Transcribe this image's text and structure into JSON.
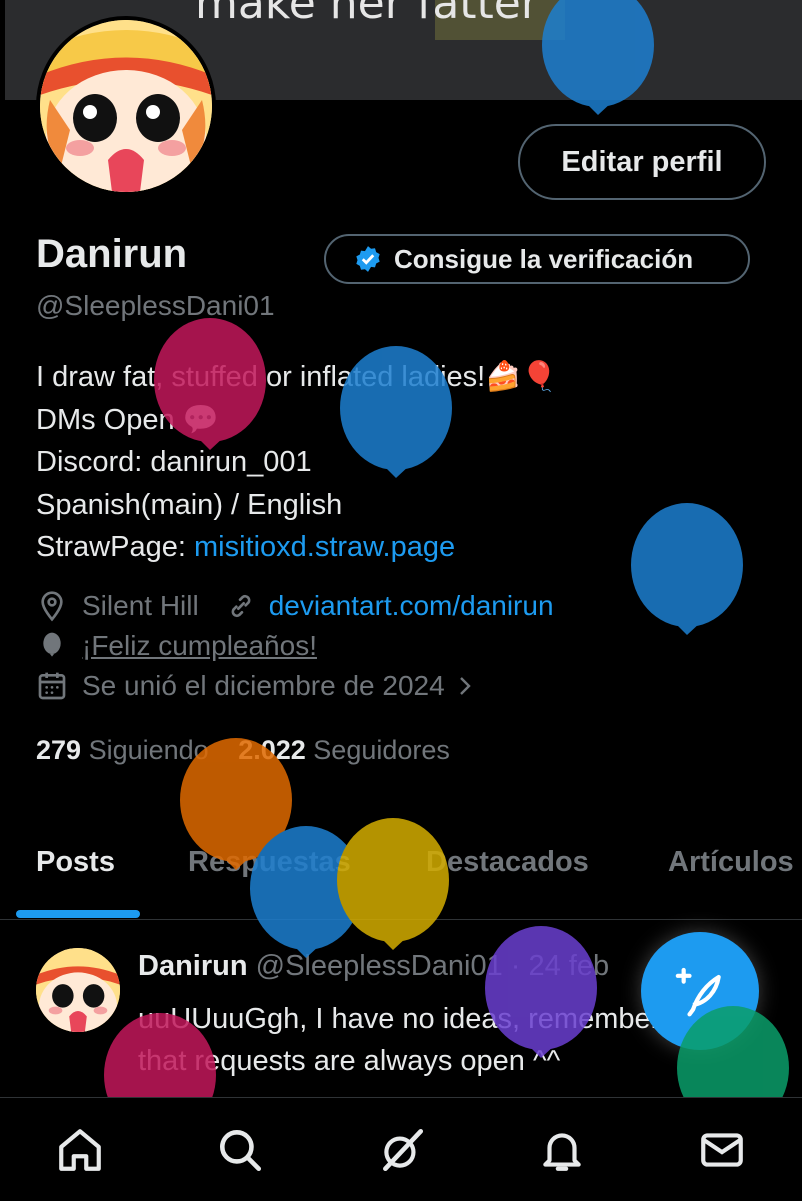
{
  "banner": {
    "text": "make her fatter"
  },
  "profile": {
    "name": "Danirun",
    "handle": "@SleeplessDani01",
    "edit_label": "Editar perfil",
    "verify_label": "Consigue la verificación",
    "bio": [
      "I draw fat, stuffed or inflated ladies!🍰🎈",
      "DMs Open 💬",
      "Discord: danirun_001",
      "Spanish(main) / English"
    ],
    "strawpage_label": "StrawPage: ",
    "strawpage_link": "misitioxd.straw.page",
    "location": "Silent Hill",
    "website": "deviantart.com/danirun",
    "birthday": "¡Feliz cumpleaños!",
    "joined": "Se unió el diciembre de 2024",
    "following_count": "279",
    "following_label": "Siguiendo",
    "followers_count": "2.022",
    "followers_label": "Seguidores"
  },
  "tabs": [
    "Posts",
    "Respuestas",
    "Destacados",
    "Artículos"
  ],
  "post": {
    "name": "Danirun",
    "handle": "@SleeplessDani01",
    "date": " · 24 feb",
    "text": "uuUUuuGgh, I have no ideas, remember that requests are always open ^^"
  },
  "icons": [
    "location-icon",
    "link-icon",
    "balloon-icon",
    "calendar-icon",
    "home-icon",
    "search-icon",
    "grok-icon",
    "bell-icon",
    "mail-icon",
    "compose-icon",
    "verified-icon"
  ],
  "colors": {
    "accent": "#1d9bf0",
    "muted": "#71767b",
    "text": "#e7e9ea",
    "border": "#536471"
  }
}
